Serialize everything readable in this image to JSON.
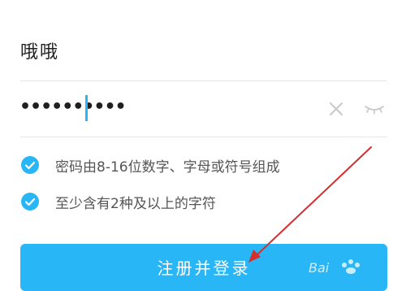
{
  "form": {
    "username": "哦哦",
    "password_masked": "••••••••••"
  },
  "rules": [
    {
      "text": "密码由8-16位数字、字母或符号组成",
      "checked": true
    },
    {
      "text": "至少含有2种及以上的字符",
      "checked": true
    }
  ],
  "submit_label": "注册并登录",
  "colors": {
    "accent": "#29b6f6",
    "arrow": "#d32f2f"
  },
  "icons": {
    "clear": "close-icon",
    "visibility": "eye-closed-icon",
    "rule_check": "check-circle-icon"
  }
}
